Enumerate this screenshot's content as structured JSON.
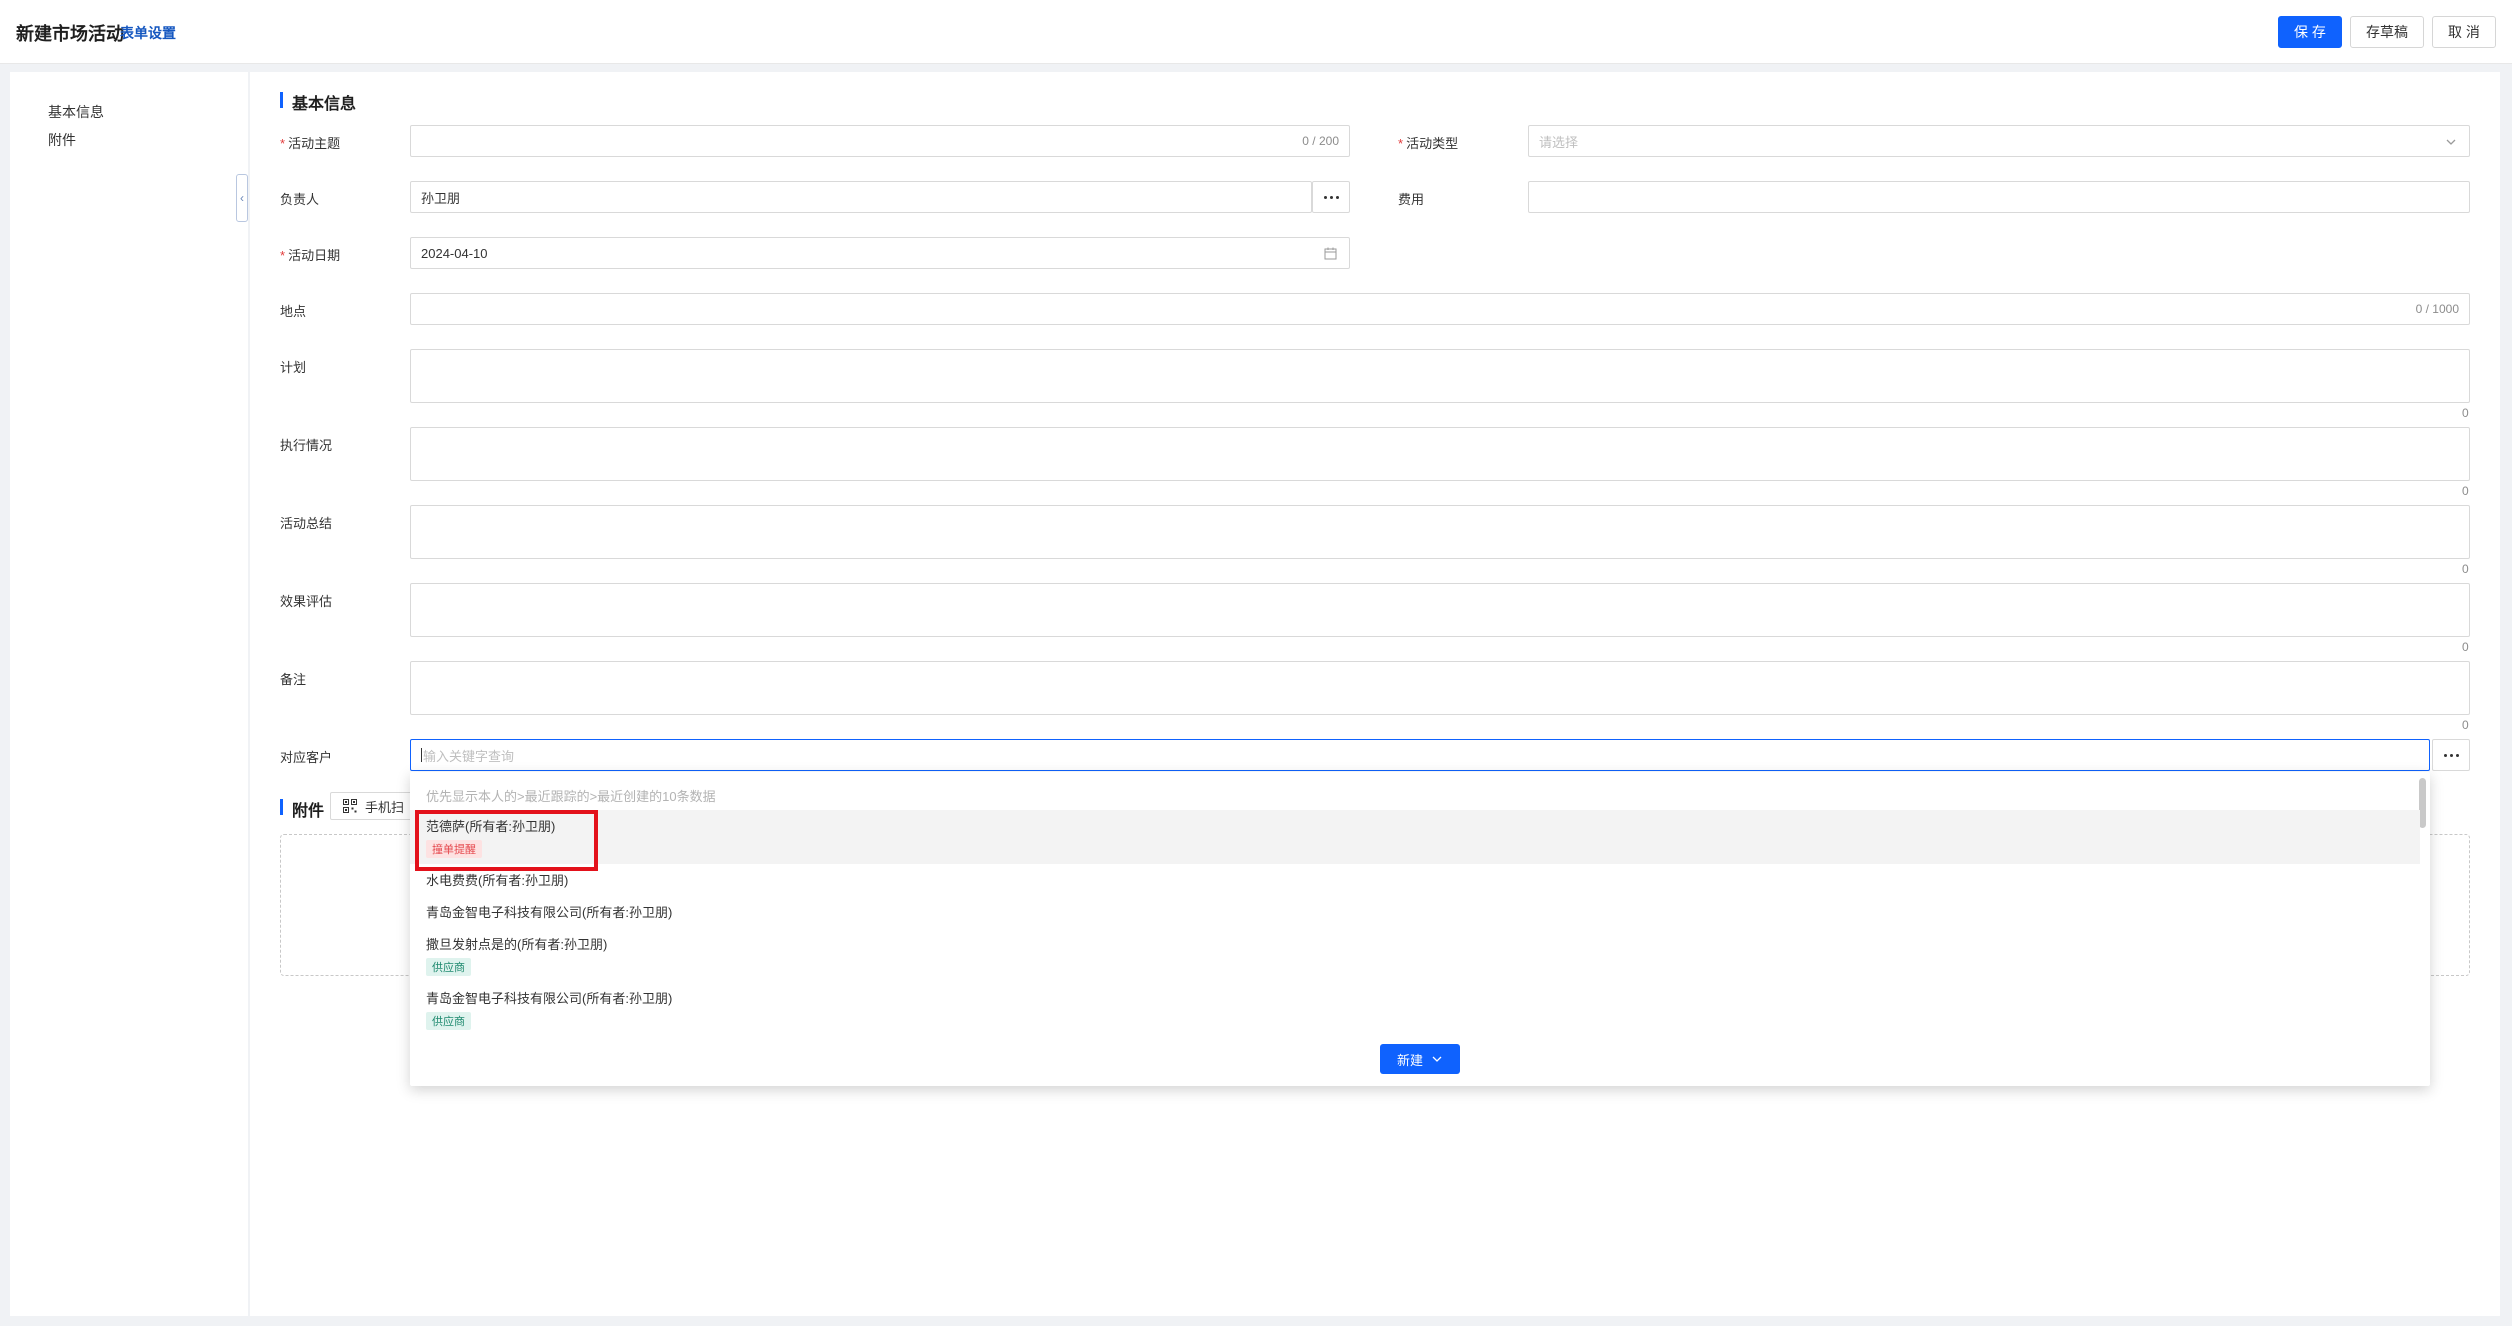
{
  "header": {
    "title": "新建市场活动",
    "form_settings": "表单设置",
    "save": "保 存",
    "draft": "存草稿",
    "cancel": "取 消"
  },
  "sidebar": {
    "items": [
      {
        "label": "基本信息"
      },
      {
        "label": "附件"
      }
    ],
    "collapse_icon": "chevron-left-icon"
  },
  "sections": {
    "basic": "基本信息",
    "attachment": "附件"
  },
  "fields": {
    "topic": {
      "label": "活动主题",
      "value": "",
      "counter": "0 / 200"
    },
    "type": {
      "label": "活动类型",
      "placeholder": "请选择"
    },
    "owner": {
      "label": "负责人",
      "value": "孙卫朋"
    },
    "cost": {
      "label": "费用",
      "value": ""
    },
    "date": {
      "label": "活动日期",
      "value": "2024-04-10"
    },
    "location": {
      "label": "地点",
      "value": "",
      "counter": "0 / 1000"
    },
    "plan": {
      "label": "计划",
      "counter": "0"
    },
    "execution": {
      "label": "执行情况",
      "counter": "0"
    },
    "summary": {
      "label": "活动总结",
      "counter": "0"
    },
    "evaluation": {
      "label": "效果评估",
      "counter": "0"
    },
    "remark": {
      "label": "备注",
      "counter": "0"
    },
    "customer": {
      "label": "对应客户",
      "placeholder": "输入关键字查询"
    }
  },
  "attachment": {
    "qr_label": "手机扫"
  },
  "dropdown": {
    "hint": "优先显示本人的>最近跟踪的>最近创建的10条数据",
    "items": [
      {
        "name": "范德萨(所有者:孙卫朋)",
        "tag": "撞单提醒"
      },
      {
        "name": "水电费费(所有者:孙卫朋)",
        "tag": ""
      },
      {
        "name": "青岛金智电子科技有限公司(所有者:孙卫朋)",
        "tag": ""
      },
      {
        "name": "撒旦发射点是的(所有者:孙卫朋)",
        "tag": "供应商"
      },
      {
        "name": "青岛金智电子科技有限公司(所有者:孙卫朋)",
        "tag": "供应商"
      }
    ],
    "new_button": "新建"
  },
  "colors": {
    "primary": "#0f62fe",
    "required": "#e23b3b",
    "highlight_box": "#e3111b"
  }
}
